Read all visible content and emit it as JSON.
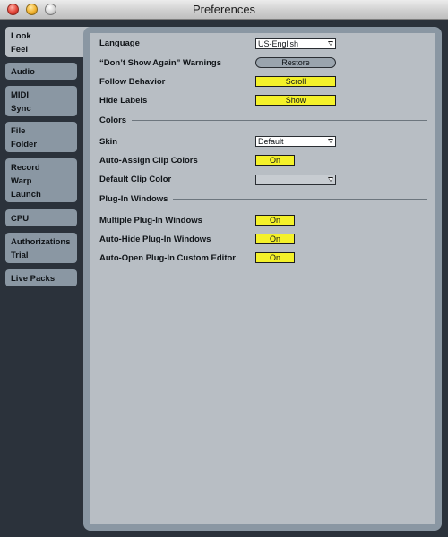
{
  "window": {
    "title": "Preferences"
  },
  "sidebar": {
    "tabs": [
      {
        "lines": [
          "Look",
          "Feel"
        ],
        "active": true
      },
      {
        "lines": [
          "Audio"
        ]
      },
      {
        "lines": [
          "MIDI",
          "Sync"
        ]
      },
      {
        "lines": [
          "File",
          "Folder"
        ]
      },
      {
        "lines": [
          "Record",
          "Warp",
          "Launch"
        ]
      },
      {
        "lines": [
          "CPU"
        ]
      },
      {
        "lines": [
          "Authorizations",
          "Trial"
        ]
      },
      {
        "lines": [
          "Live Packs"
        ]
      }
    ]
  },
  "settings": {
    "language": {
      "label": "Language",
      "value": "US-English"
    },
    "dont_show_again": {
      "label": "“Don’t Show Again” Warnings",
      "button": "Restore"
    },
    "follow_behavior": {
      "label": "Follow Behavior",
      "value": "Scroll"
    },
    "hide_labels": {
      "label": "Hide Labels",
      "value": "Show"
    }
  },
  "colors": {
    "section_title": "Colors",
    "skin": {
      "label": "Skin",
      "value": "Default"
    },
    "auto_assign_clip_colors": {
      "label": "Auto-Assign Clip Colors",
      "value": "On"
    },
    "default_clip_color": {
      "label": "Default Clip Color",
      "value": ""
    }
  },
  "plugin_windows": {
    "section_title": "Plug-In Windows",
    "multiple": {
      "label": "Multiple Plug-In Windows",
      "value": "On"
    },
    "auto_hide": {
      "label": "Auto-Hide Plug-In Windows",
      "value": "On"
    },
    "auto_open_editor": {
      "label": "Auto-Open Plug-In Custom Editor",
      "value": "On"
    }
  },
  "theme": {
    "background": "#2b323b",
    "tab_inactive": "#8a97a3",
    "panel": "#b8bec4",
    "toggle_on": "#f4f12a"
  }
}
